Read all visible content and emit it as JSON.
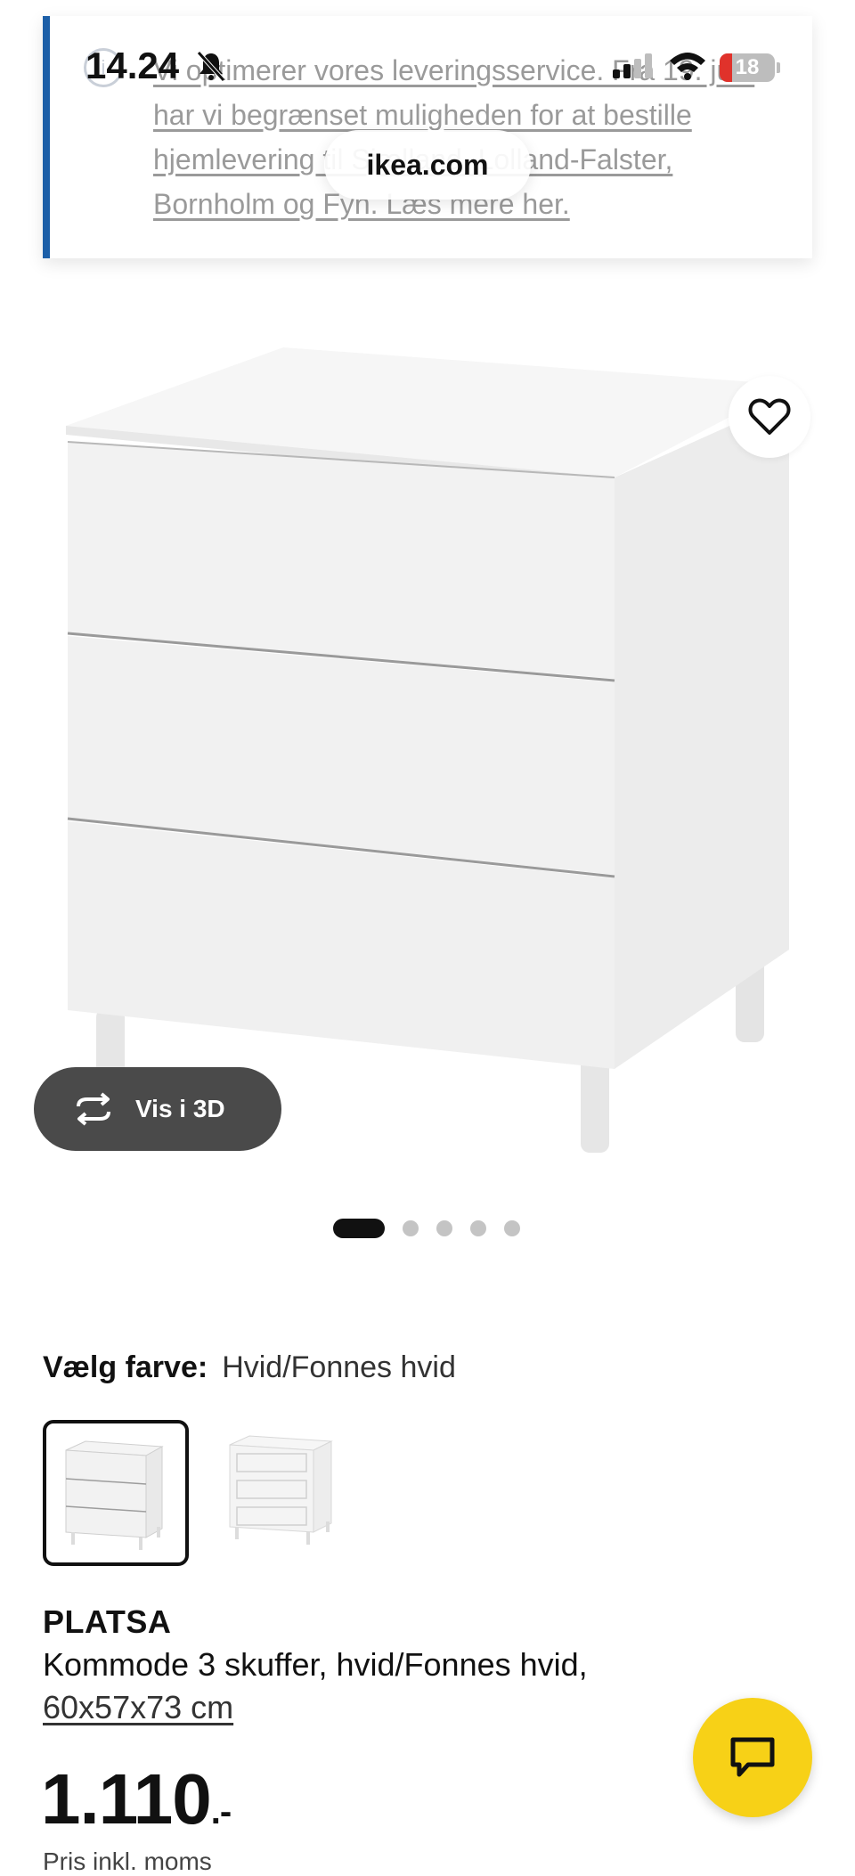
{
  "status_bar": {
    "time": "14.24",
    "battery_level": "18",
    "url": "ikea.com"
  },
  "notice": {
    "text": "Vi optimerer vores leveringsservice. Fra 19. juni har vi begrænset muligheden for at bestille hjemlevering til Sjælland, Lolland-Falster, Bornholm og Fyn. Læs mere her."
  },
  "gallery": {
    "view_3d_label": "Vis i 3D",
    "image_count": 5,
    "active_index": 0
  },
  "color_picker": {
    "label": "Vælg farve:",
    "selected_value": "Hvid/Fonnes hvid"
  },
  "product": {
    "brand": "PLATSA",
    "description": "Kommode 3 skuffer, hvid/Fonnes hvid,",
    "dimensions": "60x57x73 cm",
    "price": "1.110",
    "price_suffix": ".-",
    "price_note": "Pris inkl. moms"
  },
  "colors": {
    "accent_blue": "#1c5fa8",
    "chat_yellow": "#f7d117",
    "battery_red": "#e0322b"
  },
  "icons": [
    "info-icon",
    "bell-off-icon",
    "signal-icon",
    "wifi-icon",
    "battery-icon",
    "heart-icon",
    "rotate-3d-icon",
    "chat-icon"
  ]
}
